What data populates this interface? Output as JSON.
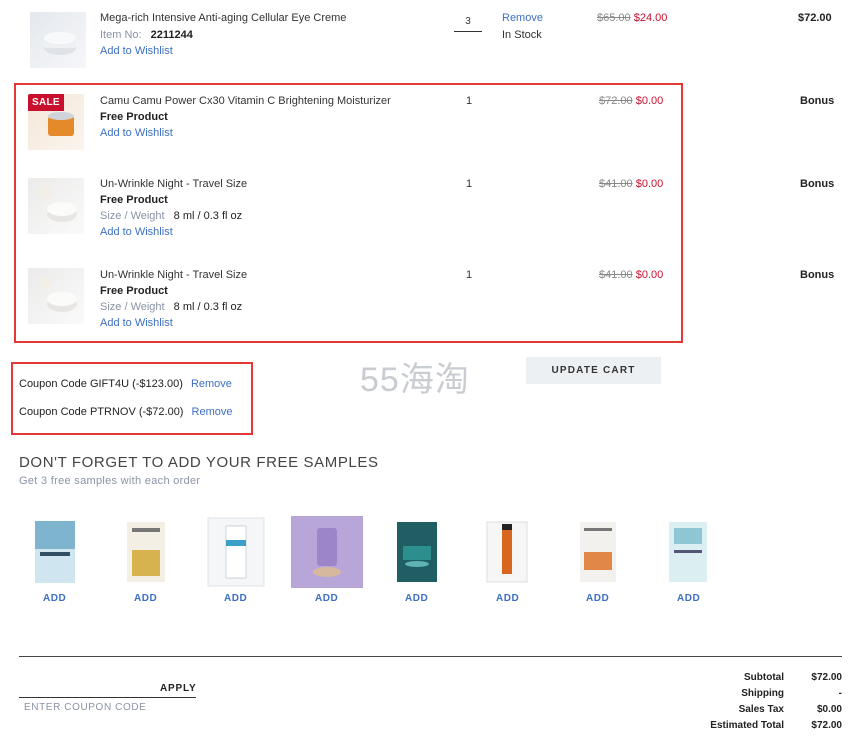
{
  "cart": {
    "items": [
      {
        "name": "Mega-rich Intensive Anti-aging Cellular Eye Creme",
        "item_no_label": "Item No:",
        "item_no": "2211244",
        "wishlist": "Add to Wishlist",
        "qty": "3",
        "remove": "Remove",
        "stock": "In Stock",
        "old_price": "$65.00",
        "new_price": "$24.00",
        "total": "$72.00"
      },
      {
        "badge": "SALE",
        "name": "Camu Camu Power Cx30 Vitamin C Brightening Moisturizer",
        "free": "Free Product",
        "wishlist": "Add to Wishlist",
        "qty": "1",
        "old_price": "$72.00",
        "new_price": "$0.00",
        "total": "Bonus"
      },
      {
        "name": "Un-Wrinkle Night - Travel Size",
        "free": "Free Product",
        "size_label": "Size / Weight",
        "size": "8 ml / 0.3 fl oz",
        "wishlist": "Add to Wishlist",
        "qty": "1",
        "old_price": "$41.00",
        "new_price": "$0.00",
        "total": "Bonus"
      },
      {
        "name": "Un-Wrinkle Night - Travel Size",
        "free": "Free Product",
        "size_label": "Size / Weight",
        "size": "8 ml / 0.3 fl oz",
        "wishlist": "Add to Wishlist",
        "qty": "1",
        "old_price": "$41.00",
        "new_price": "$0.00",
        "total": "Bonus"
      }
    ]
  },
  "coupons": [
    {
      "text": "Coupon Code GIFT4U (-$123.00)",
      "remove": "Remove"
    },
    {
      "text": "Coupon Code PTRNOV (-$72.00)",
      "remove": "Remove"
    }
  ],
  "update_cart": "UPDATE CART",
  "watermark": "55海淘",
  "samples": {
    "heading": "DON'T FORGET TO ADD YOUR FREE SAMPLES",
    "subheading": "Get 3 free samples with each order",
    "add_label": "ADD",
    "items": [
      "sample-1",
      "sample-2",
      "sample-3",
      "sample-4",
      "sample-5",
      "sample-6",
      "sample-7",
      "sample-8"
    ]
  },
  "coupon_entry": {
    "placeholder": "ENTER COUPON CODE",
    "apply": "APPLY"
  },
  "totals": {
    "subtotal_label": "Subtotal",
    "subtotal": "$72.00",
    "shipping_label": "Shipping",
    "shipping": "-",
    "tax_label": "Sales Tax",
    "tax": "$0.00",
    "estimated_label": "Estimated Total",
    "estimated": "$72.00"
  },
  "colors": {
    "highlight": "#e53935",
    "sale": "#c8102e",
    "link": "#3d6fc4"
  }
}
